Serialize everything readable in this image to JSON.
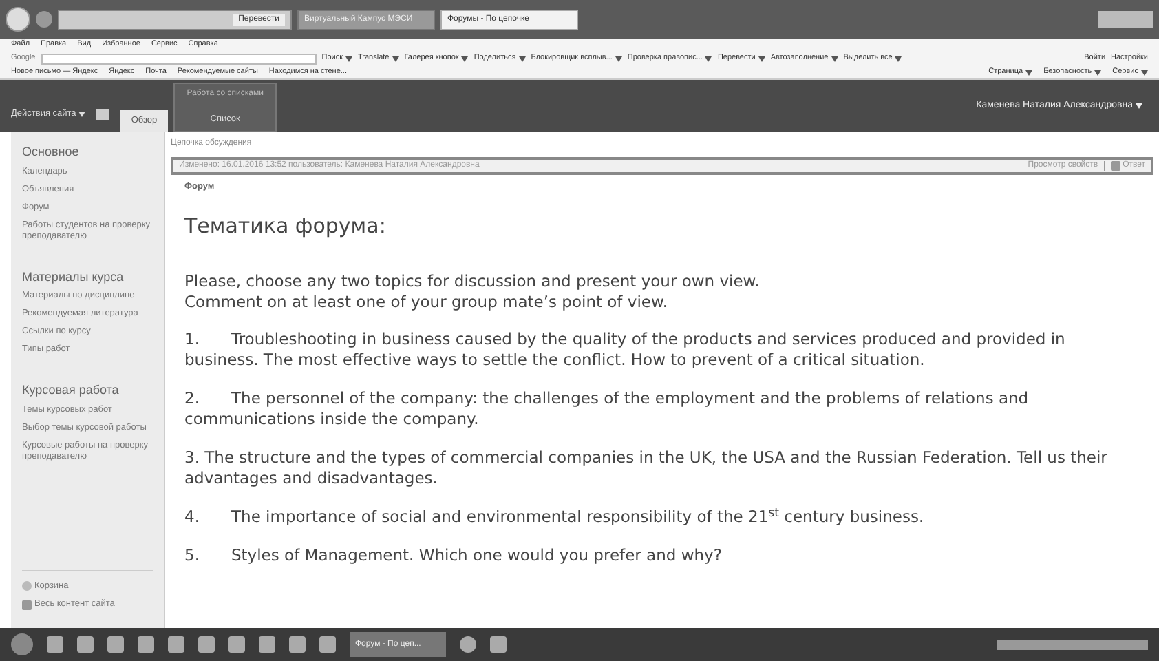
{
  "browser": {
    "tabs": [
      {
        "label": "Виртуальный Кампус МЭСИ",
        "selected": false
      },
      {
        "label": "Форумы - По цепочке",
        "selected": true
      }
    ],
    "address_button": "Перевести",
    "menu": [
      "Файл",
      "Правка",
      "Вид",
      "Избранное",
      "Сервис",
      "Справка"
    ],
    "toolbar": {
      "logo": "Google",
      "items": [
        "Поиск",
        "Translate",
        "Галерея кнопок",
        "Поделиться",
        "Блокировщик всплыв...",
        "Проверка правопис...",
        "Перевести",
        "Автозаполнение",
        "Выделить все"
      ],
      "signin": "Войти",
      "settings": "Настройки"
    },
    "favorites": [
      "Новое письмо — Яндекс",
      "Яндекс",
      "Почта",
      "Рекомендуемые сайты",
      "Находимся на стене..."
    ],
    "commands": [
      "Страница",
      "Безопасность",
      "Сервис"
    ]
  },
  "ribbon": {
    "site_actions": "Действия сайта",
    "tabs": [
      {
        "label": "Обзор",
        "selected": true
      },
      {
        "label": "Список",
        "selected": false
      }
    ],
    "group": "Работа со списками",
    "user": "Каменева Наталия Александровна"
  },
  "sidebar": {
    "sections": [
      {
        "title": "Основное",
        "items": [
          "Календарь",
          "Объявления",
          "Форум",
          "Работы студентов на проверку преподавателю"
        ]
      },
      {
        "title": "Материалы курса",
        "items": [
          "Материалы по дисциплине",
          "Рекомендуемая литература",
          "Ссылки по курсу",
          "Типы работ"
        ]
      },
      {
        "title": "Курсовая работа",
        "items": [
          "Темы курсовых работ",
          "Выбор темы курсовой работы",
          "Курсовые работы на проверку преподавателю"
        ]
      }
    ],
    "footer": [
      {
        "kind": "recycle",
        "label": "Корзина"
      },
      {
        "kind": "content",
        "label": "Весь контент сайта"
      }
    ]
  },
  "content": {
    "breadcrumb": "Цепочка обсуждения",
    "modified": "Изменено: 16.01.2016 13:52 пользователь: Каменева Наталия Александровна",
    "view_properties": "Просмотр свойств",
    "reply": "Ответ",
    "forum_label": "Форум",
    "heading": "Тематика форума:",
    "intro": [
      "Please, choose any two topics for discussion and present your own view.",
      "Comment on at least one of your group mate’s point of view."
    ],
    "topics": [
      {
        "number": "1.",
        "text": "Troubleshooting in business caused by the quality of the products and services produced and provided in business. The most effective ways to settle the conflict. How to prevent of a critical situation."
      },
      {
        "number": "2.",
        "text": "The personnel of the company: the challenges of the employment and the problems of relations and communications inside the company."
      },
      {
        "text": "3. The structure and the types of  commercial companies in the UK, the USA and the Russian Federation. Tell us their advantages and disadvantages."
      },
      {
        "number": "4.",
        "text": "The importance of social and environmental responsibility of the 21$^{st}$ century business."
      },
      {
        "number": "5.",
        "text": "Styles of Management. Which one would you prefer and why?"
      }
    ]
  },
  "taskbar": {
    "active": "Форум - По цеп..."
  }
}
